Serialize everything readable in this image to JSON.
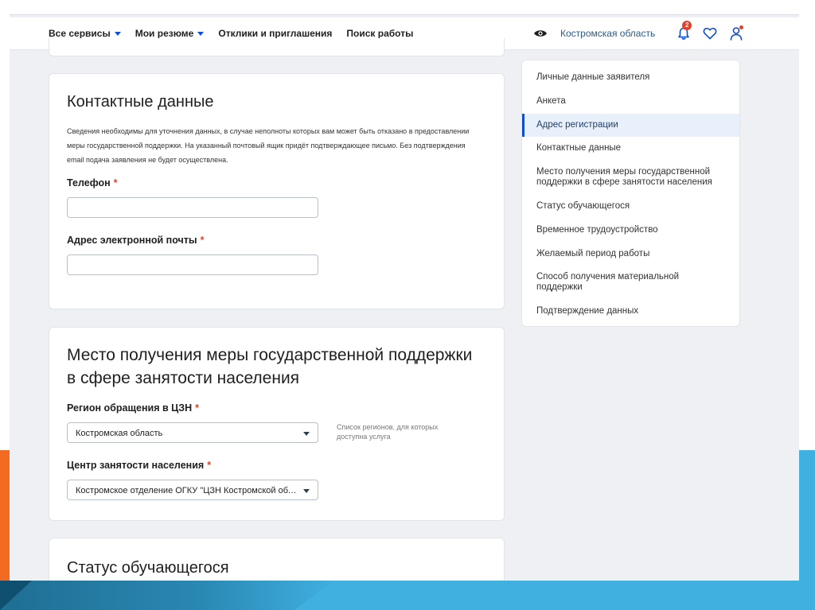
{
  "nav": {
    "items": [
      {
        "label": "Все сервисы",
        "caret": true
      },
      {
        "label": "Мои резюме",
        "caret": true
      },
      {
        "label": "Отклики и приглашения",
        "caret": false
      },
      {
        "label": "Поиск работы",
        "caret": false
      }
    ],
    "region": "Костромская область",
    "notifications_count": "2"
  },
  "contacts": {
    "title": "Контактные данные",
    "description": "Сведения необходимы для уточнения данных, в случае неполноты которых вам может быть отказано в предоставлении меры государственной поддержки. На указанный почтовый ящик придёт подтверждающее письмо. Без подтверждения email подача заявления не будет осуществлена.",
    "phone_label": "Телефон",
    "phone_value": "",
    "email_label": "Адрес электронной почты",
    "email_value": "",
    "required_mark": "*"
  },
  "place": {
    "title": "Место получения меры государственной поддержки в сфере занятости населения",
    "region_label": "Регион обращения в ЦЗН",
    "region_value": "Костромская область",
    "region_hint": "Список регионов, для которых доступна услуга",
    "center_label": "Центр занятости населения",
    "center_value": "Костромское отделение ОГКУ \"ЦЗН Костромской области\"",
    "required_mark": "*"
  },
  "status": {
    "title": "Статус обучающегося"
  },
  "sidebar": {
    "items": [
      {
        "label": "Личные данные заявителя",
        "active": false
      },
      {
        "label": "Анкета",
        "active": false
      },
      {
        "label": "Адрес регистрации",
        "active": true
      },
      {
        "label": "Контактные данные",
        "active": false
      },
      {
        "label": "Место получения меры государственной поддержки в сфере занятости населения",
        "active": false
      },
      {
        "label": "Статус обучающегося",
        "active": false
      },
      {
        "label": "Временное трудоустройство",
        "active": false
      },
      {
        "label": "Желаемый период работы",
        "active": false
      },
      {
        "label": "Способ получения материальной поддержки",
        "active": false
      },
      {
        "label": "Подтверждение данных",
        "active": false
      }
    ]
  },
  "colors": {
    "accent": "#0d4cd3",
    "required": "#e5412a",
    "slide_orange": "#f26b21",
    "slide_blue": "#3fb0e0"
  },
  "icons": {
    "visibility": "eye-icon",
    "notifications": "bell-icon",
    "favorites": "heart-icon",
    "profile": "user-icon"
  }
}
